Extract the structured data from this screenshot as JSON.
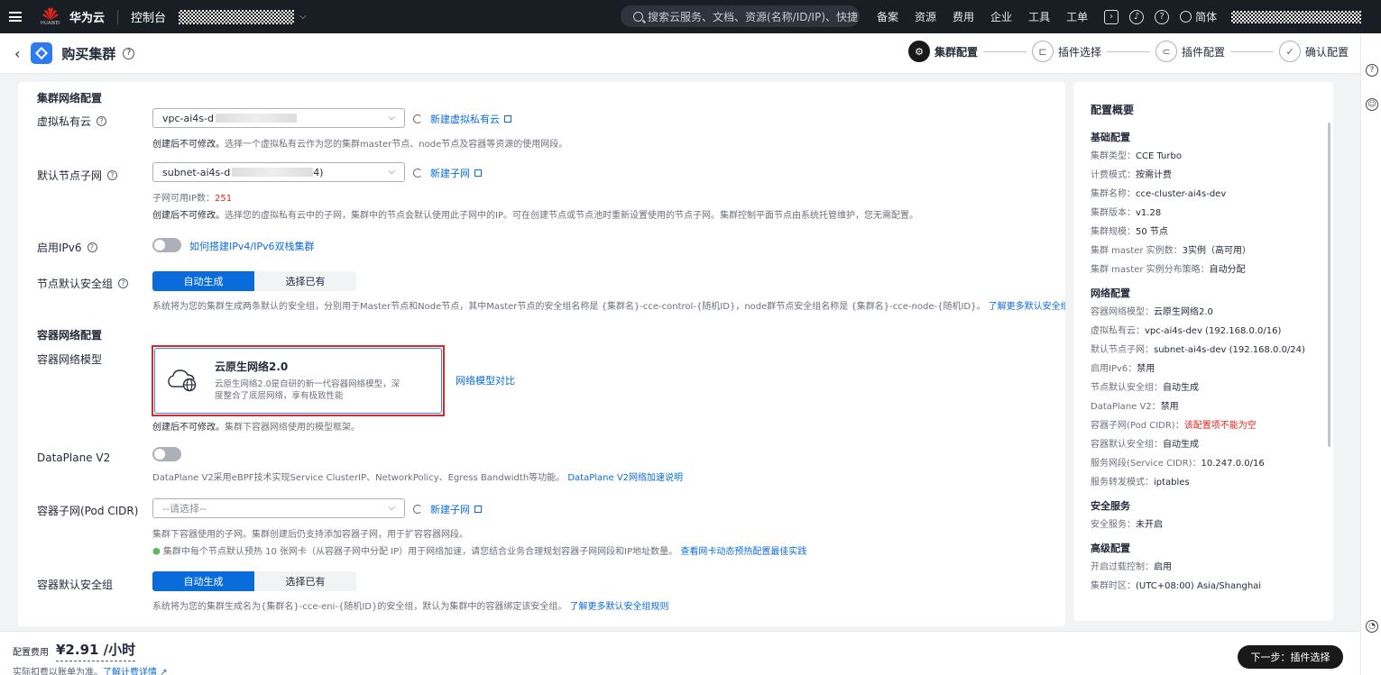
{
  "topnav": {
    "brand": "华为云",
    "brand_sub": "HUAWEI",
    "console": "控制台",
    "search_placeholder": "搜索云服务、文档、资源(名称/ID/IP)、快捷...",
    "links": [
      "备案",
      "资源",
      "费用",
      "企业",
      "工具",
      "工单"
    ],
    "lang": "简体"
  },
  "header": {
    "title": "购买集群",
    "steps": [
      {
        "label": "集群配置",
        "active": true
      },
      {
        "label": "插件选择",
        "active": false
      },
      {
        "label": "插件配置",
        "active": false
      },
      {
        "label": "确认配置",
        "active": false
      }
    ]
  },
  "form": {
    "section_network": "集群网络配置",
    "vpc": {
      "label": "虚拟私有云",
      "value": "vpc-ai4s-d",
      "new_link": "新建虚拟私有云",
      "hint_bold": "创建后不可修改。",
      "hint": "选择一个虚拟私有云作为您的集群master节点、node节点及容器等资源的使用网段。"
    },
    "subnet": {
      "label": "默认节点子网",
      "value": "subnet-ai4s-d",
      "value_tail": "4)",
      "new_link": "新建子网",
      "ip_label": "子网可用IP数：",
      "ip_count": "251",
      "hint_bold": "创建后不可修改。",
      "hint": "选择您的虚拟私有云中的子网，集群中的节点会默认使用此子网中的IP。可在创建节点或节点池时重新设置使用的节点子网。集群控制平面节点由系统托管维护，您无需配置。"
    },
    "ipv6": {
      "label": "启用IPv6",
      "link": "如何搭建IPv4/IPv6双栈集群"
    },
    "node_sg": {
      "label": "节点默认安全组",
      "opt_auto": "自动生成",
      "opt_existing": "选择已有",
      "hint": "系统将为您的集群生成两条默认的安全组，分别用于Master节点和Node节点，其中Master节点的安全组名称是 {集群名}-cce-control-{随机ID}，node群节点安全组名称是 {集群名}-cce-node-{随机ID}。",
      "link": "了解更多默认安全组规则"
    },
    "section_container": "容器网络配置",
    "model": {
      "label": "容器网络模型",
      "card_title": "云原生网络2.0",
      "card_desc": "云原生网络2.0是自研的新一代容器网络模型，深度整合了底层网络，享有极致性能",
      "compare_link": "网络模型对比",
      "hint_bold": "创建后不可修改。",
      "hint": "集群下容器网络使用的模型框架。"
    },
    "dataplane": {
      "label": "DataPlane V2",
      "hint": "DataPlane V2采用eBPF技术实现Service ClusterIP、NetworkPolicy、Egress Bandwidth等功能。",
      "link": "DataPlane V2网络加速说明"
    },
    "pod_cidr": {
      "label": "容器子网(Pod CIDR)",
      "placeholder": "--请选择--",
      "new_link": "新建子网",
      "hint": "集群下容器使用的子网。集群创建后仍支持添加容器子网，用于扩容容器网段。",
      "tip": "集群中每个节点默认预热 10 张网卡（从容器子网中分配 IP）用于网络加速，请您结合业务合理规划容器子网网段和IP地址数量。",
      "tip_link": "查看网卡动态预热配置最佳实践"
    },
    "container_sg": {
      "label": "容器默认安全组",
      "opt_auto": "自动生成",
      "opt_existing": "选择已有",
      "hint": "系统将为您的集群生成名为{集群名}-cce-eni-{随机ID}的安全组，默认为集群中的容器绑定该安全组。",
      "link": "了解更多默认安全组规则"
    }
  },
  "summary": {
    "title": "配置概要",
    "groups": [
      {
        "name": "基础配置",
        "rows": [
          [
            "集群类型：",
            "CCE Turbo"
          ],
          [
            "计费模式：",
            "按需计费"
          ],
          [
            "集群名称：",
            "cce-cluster-ai4s-dev"
          ],
          [
            "集群版本：",
            "v1.28"
          ],
          [
            "集群规模：",
            "50 节点"
          ],
          [
            "集群 master 实例数：",
            "3实例（高可用）"
          ],
          [
            "集群 master 实例分布策略：",
            "自动分配"
          ]
        ]
      },
      {
        "name": "网络配置",
        "rows": [
          [
            "容器网络模型：",
            "云原生网络2.0"
          ],
          [
            "虚拟私有云：",
            "vpc-ai4s-dev (192.168.0.0/16)"
          ],
          [
            "默认节点子网：",
            "subnet-ai4s-dev (192.168.0.0/24)"
          ],
          [
            "启用IPv6：",
            "禁用"
          ],
          [
            "节点默认安全组：",
            "自动生成"
          ],
          [
            "DataPlane V2：",
            "禁用"
          ],
          [
            "容器子网(Pod CIDR)：",
            "该配置项不能为空"
          ],
          [
            "容器默认安全组：",
            "自动生成"
          ],
          [
            "服务网段(Service CIDR)：",
            "10.247.0.0/16"
          ],
          [
            "服务转发模式：",
            "iptables"
          ]
        ]
      },
      {
        "name": "安全服务",
        "rows": [
          [
            "安全服务：",
            "未开启"
          ]
        ]
      },
      {
        "name": "高级配置",
        "rows": [
          [
            "开启过载控制：",
            "启用"
          ],
          [
            "集群时区：",
            "(UTC+08:00) Asia/Shanghai"
          ]
        ]
      }
    ]
  },
  "footer": {
    "fee_label": "配置费用",
    "fee_value": "¥2.91 /小时",
    "note": "实际扣费以账单为准。",
    "note_link": "了解计费详情",
    "next_button": "下一步：插件选择"
  },
  "colors": {
    "accent": "#0a6cdb",
    "topnav_bg": "#191d24",
    "error": "#e1251b",
    "highlight_border": "#d52b2b"
  }
}
